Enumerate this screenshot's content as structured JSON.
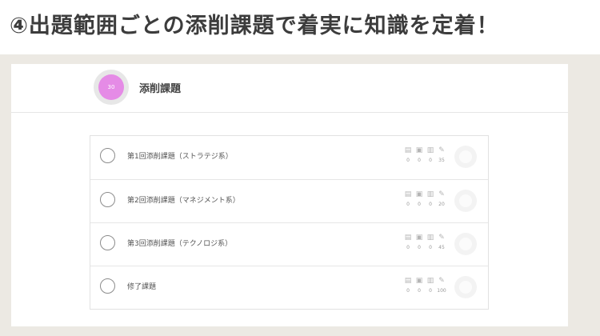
{
  "heading": "④出題範囲ごとの添削課題で着実に知識を定着！",
  "section": {
    "badge_text": "30",
    "title": "添削課題"
  },
  "tasks": [
    {
      "label": "第1回添削課題（ストラテジ系）",
      "stats": [
        "0",
        "0",
        "0",
        "35"
      ]
    },
    {
      "label": "第2回添削課題（マネジメント系）",
      "stats": [
        "0",
        "0",
        "0",
        "20"
      ]
    },
    {
      "label": "第3回添削課題（テクノロジ系）",
      "stats": [
        "0",
        "0",
        "0",
        "45"
      ]
    },
    {
      "label": "修了課題",
      "stats": [
        "0",
        "0",
        "0",
        "100"
      ]
    }
  ],
  "stat_icon_names": [
    "book-icon",
    "video-icon",
    "document-icon",
    "pencil-icon"
  ],
  "colors": {
    "accent": "#e58be6",
    "frame": "#ece9e3",
    "text": "#555555"
  }
}
